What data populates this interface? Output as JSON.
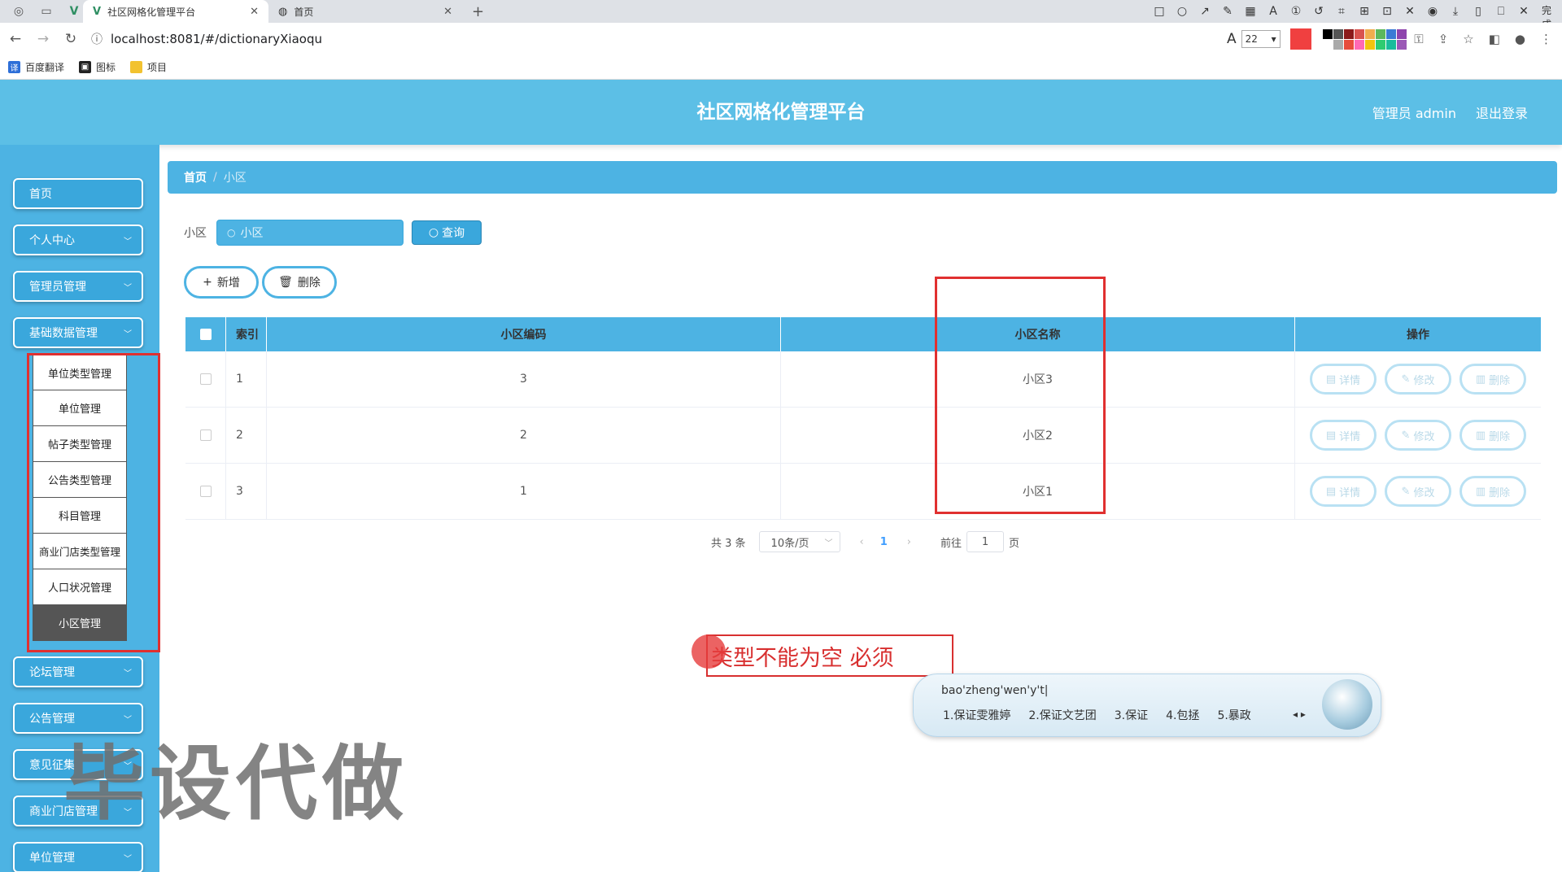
{
  "browser": {
    "tabs": [
      {
        "title": "社区网格化管理平台",
        "active": true
      },
      {
        "title": "首页",
        "active": false
      }
    ],
    "url": "localhost:8081/#/dictionaryXiaoqu",
    "font_size_value": "22",
    "done_label": "完成",
    "bookmarks": [
      {
        "label": "百度翻译",
        "icon_color": "#2e6fd8"
      },
      {
        "label": "图标",
        "icon_color": "#222222"
      },
      {
        "label": "项目",
        "icon_color": "#f2c230"
      }
    ],
    "palette": [
      "#000000",
      "#555555",
      "#8b1a1a",
      "#d9534f",
      "#f0ad4e",
      "#5cb85c",
      "#3a7bd5",
      "#8e44ad",
      "#ffffff",
      "#aaaaaa",
      "#e74c3c",
      "#ff69b4",
      "#f1c40f",
      "#2ecc71",
      "#1abc9c",
      "#9b59b6"
    ],
    "accent_color": "#f04040"
  },
  "header": {
    "title": "社区网格化管理平台",
    "user_label": "管理员 admin",
    "logout_label": "退出登录"
  },
  "sidebar": {
    "items_top": [
      {
        "label": "首页",
        "has_chevron": false
      },
      {
        "label": "个人中心",
        "has_chevron": true
      },
      {
        "label": "管理员管理",
        "has_chevron": true
      },
      {
        "label": "基础数据管理",
        "has_chevron": true
      }
    ],
    "submenu": [
      {
        "label": "单位类型管理",
        "active": false
      },
      {
        "label": "单位管理",
        "active": false
      },
      {
        "label": "帖子类型管理",
        "active": false
      },
      {
        "label": "公告类型管理",
        "active": false
      },
      {
        "label": "科目管理",
        "active": false
      },
      {
        "label": "商业门店类型管理",
        "active": false
      },
      {
        "label": "人口状况管理",
        "active": false
      },
      {
        "label": "小区管理",
        "active": true
      }
    ],
    "items_bottom": [
      {
        "label": "论坛管理"
      },
      {
        "label": "公告管理"
      },
      {
        "label": "意见征集"
      },
      {
        "label": "商业门店管理"
      },
      {
        "label": "单位管理"
      }
    ]
  },
  "breadcrumb": {
    "home": "首页",
    "current": "小区"
  },
  "search": {
    "label": "小区",
    "placeholder": "小区",
    "button": "查询"
  },
  "actions": {
    "add": "新增",
    "delete": "删除"
  },
  "table": {
    "headers": {
      "index": "索引",
      "code": "小区编码",
      "name": "小区名称",
      "ops": "操作"
    },
    "rows": [
      {
        "index": "1",
        "code": "3",
        "name": "小区3"
      },
      {
        "index": "2",
        "code": "2",
        "name": "小区2"
      },
      {
        "index": "3",
        "code": "1",
        "name": "小区1"
      }
    ],
    "row_ops": {
      "detail": "详情",
      "edit": "修改",
      "delete": "删除"
    }
  },
  "pagination": {
    "total": "共 3 条",
    "page_size": "10条/页",
    "current_page": "1",
    "goto_prefix": "前往",
    "goto_value": "1",
    "goto_suffix": "页"
  },
  "annotation": {
    "text": "类型不能为空 必须"
  },
  "ime": {
    "pinyin": "bao'zheng'wen'y't|",
    "candidates": [
      "1.保证雯雅婷",
      "2.保证文艺团",
      "3.保证",
      "4.包拯",
      "5.暴政"
    ]
  },
  "watermark": "毕设代做"
}
